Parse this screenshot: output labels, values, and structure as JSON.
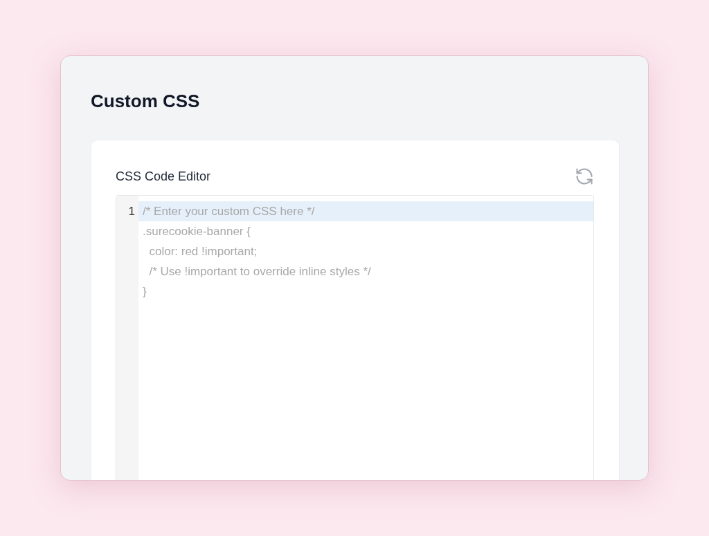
{
  "panel": {
    "title": "Custom CSS"
  },
  "card": {
    "label": "CSS Code Editor"
  },
  "editor": {
    "gutter": [
      {
        "number": "1",
        "active": true
      }
    ],
    "placeholder": "/* Enter your custom CSS here */\n.surecookie-banner {\n  color: red !important;\n  /* Use !important to override inline styles */\n}"
  }
}
